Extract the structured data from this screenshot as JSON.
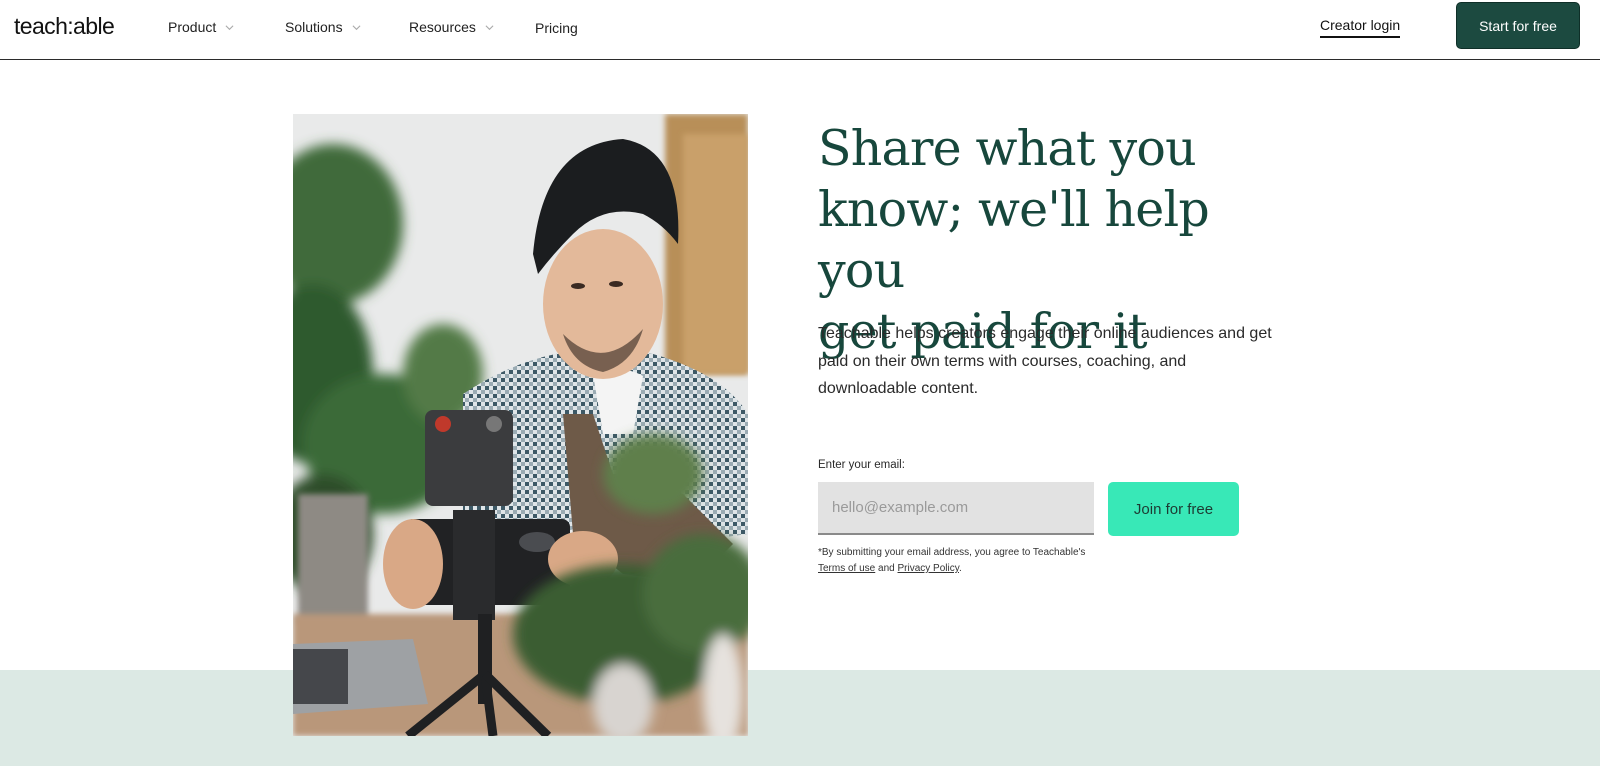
{
  "header": {
    "logo": "teach:able",
    "nav": [
      {
        "label": "Product",
        "has_dropdown": true
      },
      {
        "label": "Solutions",
        "has_dropdown": true
      },
      {
        "label": "Resources",
        "has_dropdown": true
      },
      {
        "label": "Pricing",
        "has_dropdown": false
      }
    ],
    "creator_login": "Creator login",
    "cta": "Start for free"
  },
  "hero": {
    "headline": [
      "Share what you",
      "know; we'll help you",
      "get paid for it"
    ],
    "subtext": "Teachable helps creators engage their online audiences and get paid on their own terms with courses, coaching, and downloadable content.",
    "image_alt": "Creator setting up a phone camera on a tripod among plants",
    "form": {
      "label": "Enter your email:",
      "placeholder": "hello@example.com",
      "value": "",
      "submit": "Join for free",
      "legal_prefix": "*By submitting your email address, you agree to Teachable's",
      "terms_link": "Terms of use",
      "legal_and": "and",
      "privacy_link": "Privacy Policy",
      "legal_suffix": "."
    }
  },
  "colors": {
    "brand_dark": "#1c4a40",
    "headline": "#17473c",
    "accent": "#38e8b7",
    "band": "#dce9e4"
  }
}
